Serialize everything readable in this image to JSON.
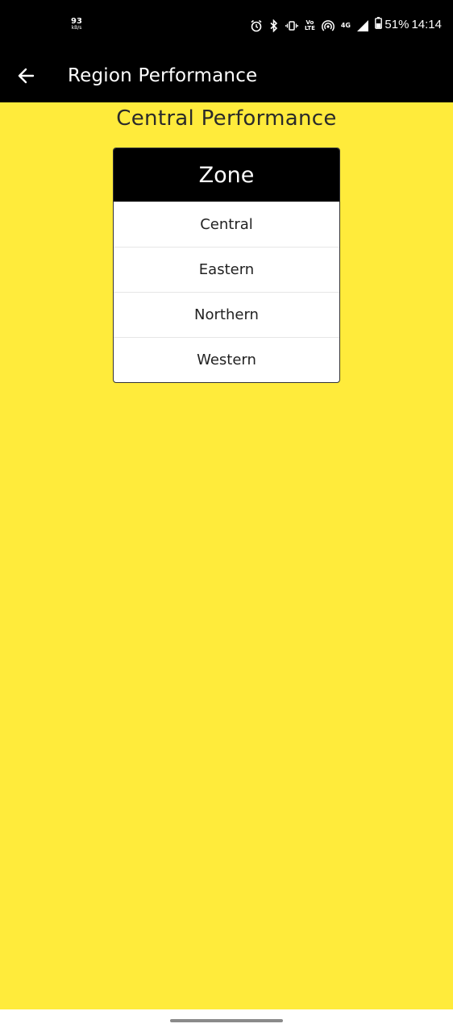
{
  "status_bar": {
    "net_speed_value": "93",
    "net_speed_unit": "kB/s",
    "volte_line1": "Vo",
    "volte_line2": "LTE",
    "network_type": "4G",
    "battery_percent": "51%",
    "time": "14:14",
    "icons": [
      "alarm-icon",
      "bluetooth-icon",
      "vibrate-icon",
      "volte-icon",
      "hotspot-icon",
      "signal-icon",
      "battery-icon"
    ]
  },
  "app_bar": {
    "back_icon": "arrow-left-icon",
    "title": "Region Performance"
  },
  "main": {
    "section_title": "Central Performance",
    "table": {
      "header": "Zone",
      "rows": [
        "Central",
        "Eastern",
        "Northern",
        "Western"
      ]
    }
  },
  "colors": {
    "background": "#ffeb3b",
    "app_bar": "#000000",
    "table_header": "#000000",
    "table_body": "#ffffff"
  }
}
